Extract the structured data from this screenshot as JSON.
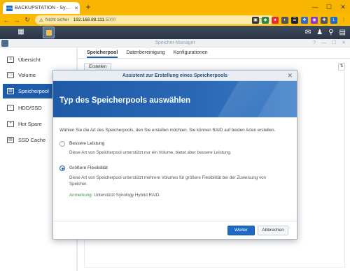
{
  "browser": {
    "tab_title": "BACKUPSTATION - Synology DiskStation",
    "tab_favicon": "DSM",
    "new_tab": "+",
    "insecure_label": "Nicht sicher",
    "url_host": "192.168.88.111",
    "url_port": ":5000",
    "ext_letter": "L"
  },
  "dsm": {
    "window_title": "Speicher-Manager"
  },
  "sidebar": {
    "items": [
      {
        "label": "Übersicht",
        "icon": "overview-icon",
        "glyph": "≡"
      },
      {
        "label": "Volume",
        "icon": "volume-icon",
        "glyph": "▭"
      },
      {
        "label": "Speicherpool",
        "icon": "storage-pool-icon",
        "glyph": "▥"
      },
      {
        "label": "HDD/SSD",
        "icon": "hdd-icon",
        "glyph": "▫"
      },
      {
        "label": "Hot Spare",
        "icon": "hot-spare-icon",
        "glyph": "+"
      },
      {
        "label": "SSD Cache",
        "icon": "ssd-cache-icon",
        "glyph": "▤"
      }
    ],
    "active_index": 2
  },
  "content": {
    "tabs": [
      "Speicherpool",
      "Datenbereinigung",
      "Konfigurationen"
    ],
    "create_label": "Erstellen"
  },
  "modal": {
    "title": "Assistent zur Erstellung eines Speicherpools",
    "heading": "Typ des Speicherpools auswählen",
    "description": "Wählen Sie die Art des Speicherpools, den Sie erstellen möchten. Sie können RAID auf beiden Arten erstellen.",
    "option1_label": "Bessere Leistung",
    "option1_desc": "Diese Art von Speicherpool unterstützt nur ein Volume, bietet aber bessere Leistung.",
    "option2_label": "Größere Flexibilität",
    "option2_desc": "Diese Art von Speicherpool unterstützt mehrere Volumes für größere Flexibilität bei der Zuweisung von Speicher.",
    "note_label": "Anmerkung:",
    "note_text": " Unterstützt Synology Hybrid RAID.",
    "selected_option": 2,
    "next_label": "Weiter",
    "cancel_label": "Abbrechen"
  }
}
